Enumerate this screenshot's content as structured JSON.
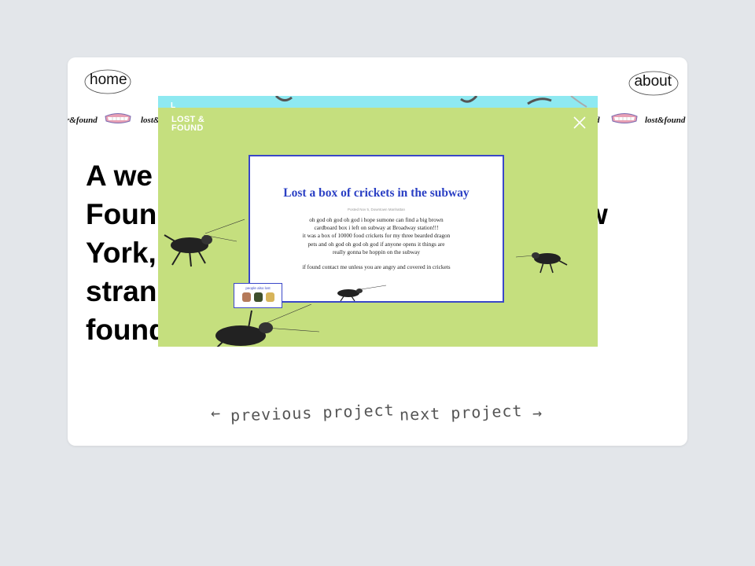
{
  "nav": {
    "home_label": "home",
    "about_label": "about"
  },
  "marquee": {
    "left_fragment": "r&found",
    "item": "lost&found",
    "item_mid_right": "d"
  },
  "headline": {
    "lines": [
      "A we",
      "Foun",
      "York,",
      "stran",
      "found"
    ],
    "line2_tail": "w"
  },
  "modal": {
    "logo_line1": "LOST &",
    "logo_line2": "FOUND",
    "close_icon": "close-x-icon",
    "post": {
      "title": "Lost a box of crickets in the subway",
      "meta": "Posted Nov 5, Downtown Manhattan",
      "body": "oh god oh god oh god i hope sumone can find a big brown\ncardboard box i left on subway at Broadway station!!!\nit was a box of 10000 food crickets for my three bearded dragon\npets and oh god oh god oh god if anyone opens it things are\nreally gonna be hoppin on the subway",
      "footer": "if found contact me unless you are angry and covered in crickets"
    },
    "people_also_lost": {
      "label": "people also lost"
    }
  },
  "project_nav": {
    "previous_label": "previous project",
    "next_label": "next project"
  },
  "colors": {
    "overlay": "#c5df7e",
    "accent": "#3a47c8",
    "strip": "#8ee9f1"
  }
}
